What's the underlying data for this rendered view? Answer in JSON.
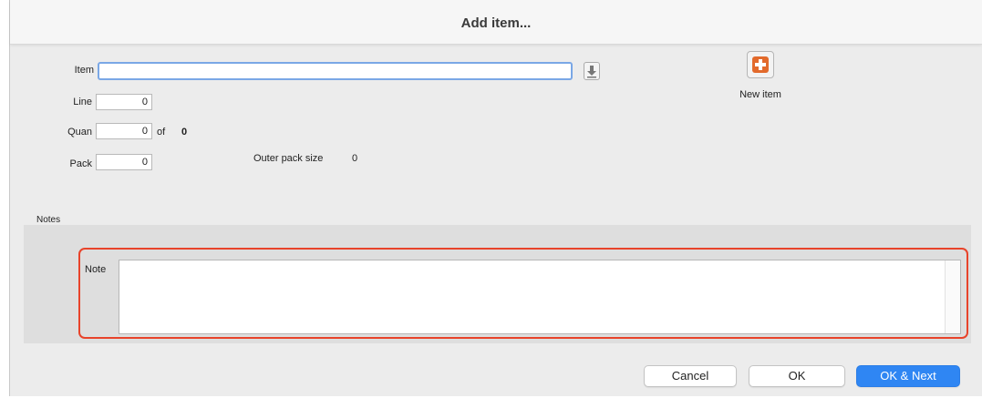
{
  "window": {
    "title": "Add item..."
  },
  "form": {
    "item_label": "Item",
    "item_value": "",
    "line_label": "Line",
    "line_value": "0",
    "quan_label": "Quan",
    "quan_value": "0",
    "of_label": "of",
    "of_value": "0",
    "pack_label": "Pack",
    "pack_value": "0",
    "outer_pack_label": "Outer pack size",
    "outer_pack_value": "0"
  },
  "new_item": {
    "label": "New item",
    "icon": "plus-icon",
    "icon_color": "#e26a2c"
  },
  "notes": {
    "section_label": "Notes",
    "note_label": "Note",
    "note_value": "",
    "highlight_color": "#e8432a"
  },
  "buttons": {
    "cancel": "Cancel",
    "ok": "OK",
    "ok_next": "OK & Next",
    "accent": "#2f86f3"
  }
}
